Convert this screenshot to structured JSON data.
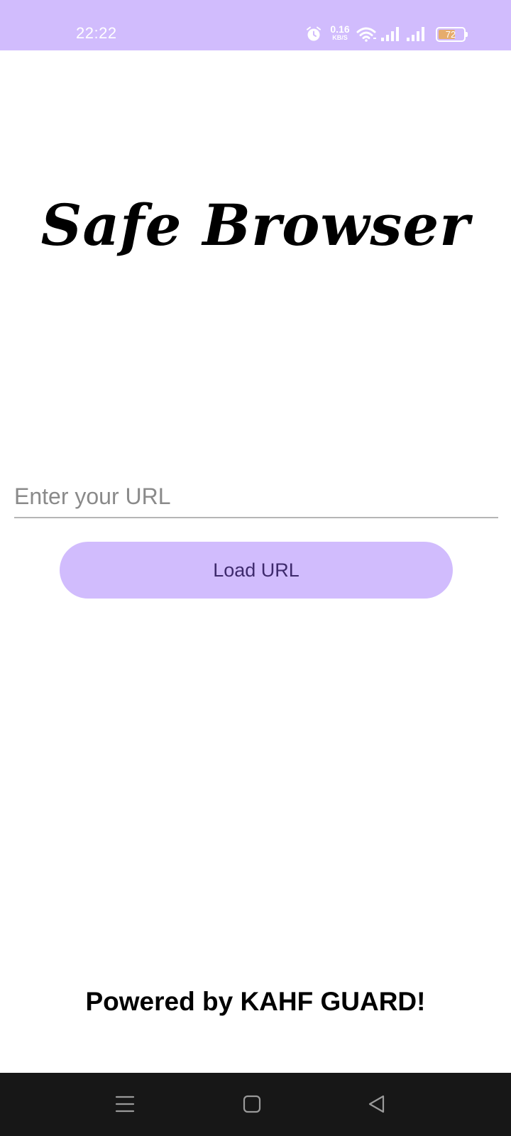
{
  "status_bar": {
    "time": "22:22",
    "net_speed_value": "0.16",
    "net_speed_unit": "KB/S",
    "battery_level": "72",
    "icons": [
      "alarm-icon",
      "wifi-icon",
      "signal-icon",
      "signal-icon",
      "battery-icon"
    ]
  },
  "app": {
    "title": "Safe Browser"
  },
  "url_input": {
    "value": "",
    "placeholder": "Enter your URL"
  },
  "load_button": {
    "label": "Load URL"
  },
  "footer": {
    "powered_by": "Powered by KAHF GUARD!"
  },
  "nav_bar": {
    "icons": [
      "menu-icon",
      "home-icon",
      "back-icon"
    ]
  },
  "colors": {
    "accent": "#d1bcfd",
    "button_text": "#3e2a6d",
    "nav_background": "#171717",
    "battery_fill": "#e6ac6c"
  }
}
